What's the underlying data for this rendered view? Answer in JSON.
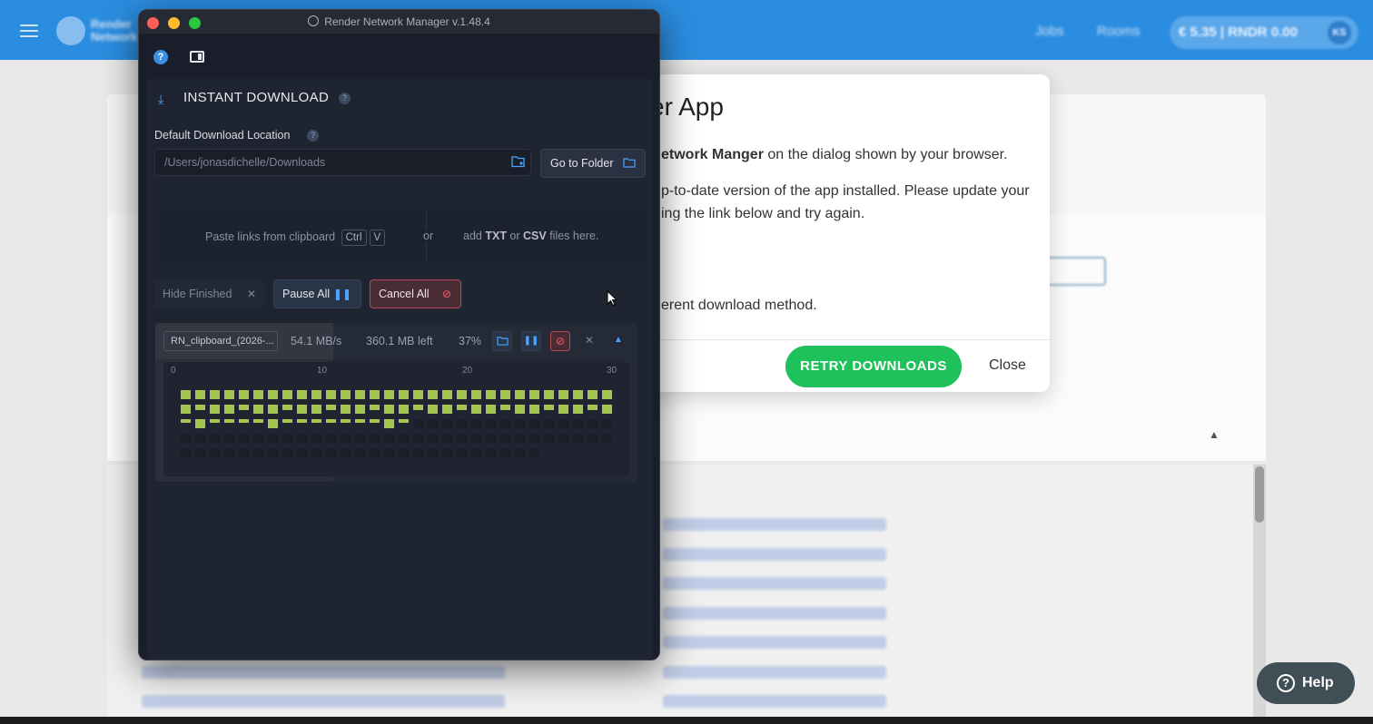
{
  "background_app": {
    "brand": [
      "Render",
      "Network"
    ],
    "nav": [
      "Jobs",
      "Rooms"
    ],
    "balance": "€ 5.35 | RNDR 0.00",
    "avatar_initials": "KS",
    "help_label": "Help"
  },
  "modal": {
    "title": "er App",
    "line1_bold": "etwork Manger",
    "line1_rest": " on the dialog shown by your browser.",
    "line2": "p-to-date version of the app installed. Please update your",
    "line3": "ing the link below and try again.",
    "line4": "erent download method.",
    "retry_label": "RETRY DOWNLOADS",
    "close_label": "Close",
    "accent_color": "#1fc15a"
  },
  "window": {
    "title": "Render Network Manager v.1.48.4",
    "section_title": "INSTANT DOWNLOAD",
    "location_label": "Default Download Location",
    "location_value": "/Users/jonasdichelle/Downloads",
    "goto_folder_label": "Go to Folder",
    "paste_text": "Paste links from clipboard",
    "key_ctrl": "Ctrl",
    "key_v": "V",
    "or_text": "or",
    "add_prefix": "add ",
    "add_txt": "TXT",
    "add_or": " or ",
    "add_csv": "CSV",
    "add_suffix": " files here.",
    "hide_finished_label": "Hide Finished",
    "pause_all_label": "Pause All",
    "cancel_all_label": "Cancel All",
    "accent_color": "#4aa3ff"
  },
  "task": {
    "name": "RN_clipboard_(2026-...",
    "speed": "54.1 MB/s",
    "remaining": "360.1 MB left",
    "percent_label": "37%",
    "progress": 0.37,
    "ticks": [
      "0",
      "10",
      "20",
      "30"
    ]
  }
}
